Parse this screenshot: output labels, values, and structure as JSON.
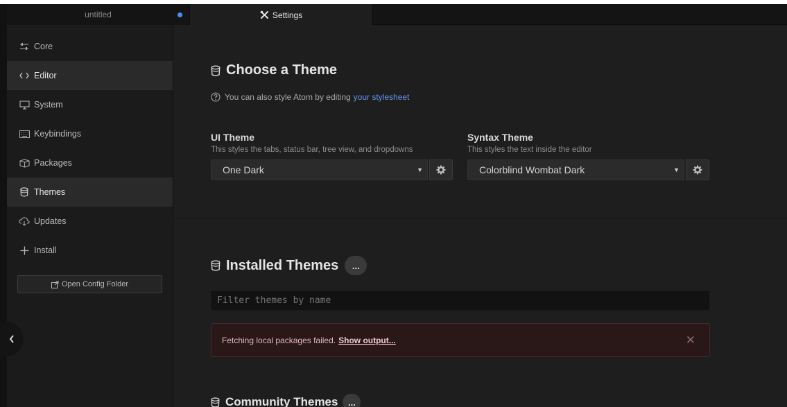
{
  "tabs": [
    {
      "label": "untitled"
    },
    {
      "label": "Settings"
    }
  ],
  "sidebar": {
    "items": [
      {
        "label": "Core",
        "icon": "sliders-icon"
      },
      {
        "label": "Editor",
        "icon": "code-icon"
      },
      {
        "label": "System",
        "icon": "monitor-icon"
      },
      {
        "label": "Keybindings",
        "icon": "keyboard-icon"
      },
      {
        "label": "Packages",
        "icon": "package-icon"
      },
      {
        "label": "Themes",
        "icon": "paintcan-icon"
      },
      {
        "label": "Updates",
        "icon": "cloud-download-icon"
      },
      {
        "label": "Install",
        "icon": "plus-icon"
      }
    ],
    "active": "Themes",
    "config_button": "Open Config Folder"
  },
  "choose_theme": {
    "title": "Choose a Theme",
    "hint": "You can also style Atom by editing",
    "hint_link": "your stylesheet",
    "ui_theme": {
      "title": "UI Theme",
      "desc": "This styles the tabs, status bar, tree view, and dropdowns",
      "value": "One Dark"
    },
    "syntax_theme": {
      "title": "Syntax Theme",
      "desc": "This styles the text inside the editor",
      "value": "Colorblind Wombat Dark"
    }
  },
  "installed_themes": {
    "title": "Installed Themes",
    "more": "...",
    "filter_placeholder": "Filter themes by name",
    "alert_text": "Fetching local packages failed.",
    "alert_link": "Show output..."
  },
  "community_themes": {
    "title": "Community Themes",
    "more": "..."
  },
  "colors": {
    "accent_link": "#6494ed",
    "modified_dot": "#4d8ef5",
    "alert_bg": "#2a1717"
  }
}
